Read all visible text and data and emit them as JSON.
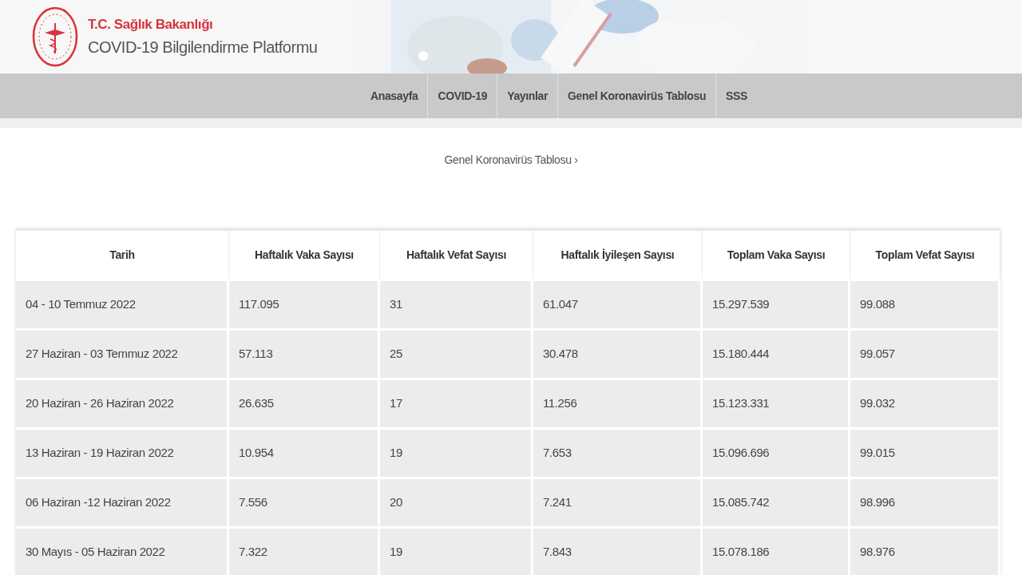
{
  "header": {
    "ministry": "T.C. Sağlık Bakanlığı",
    "platform": "COVID-19 Bilgilendirme Platformu"
  },
  "nav": [
    {
      "label": "Anasayfa"
    },
    {
      "label": "COVID-19"
    },
    {
      "label": "Yayınlar"
    },
    {
      "label": "Genel Koronavirüs Tablosu"
    },
    {
      "label": "SSS"
    }
  ],
  "breadcrumb": {
    "label": "Genel Koronavirüs Tablosu",
    "chevron": "›"
  },
  "table": {
    "columns": [
      "Tarih",
      "Haftalık Vaka Sayısı",
      "Haftalık Vefat Sayısı",
      "Haftalık İyileşen Sayısı",
      "Toplam Vaka Sayısı",
      "Toplam Vefat Sayısı"
    ],
    "rows": [
      [
        "04 - 10 Temmuz 2022",
        "117.095",
        "31",
        "61.047",
        "15.297.539",
        "99.088"
      ],
      [
        "27 Haziran - 03 Temmuz 2022",
        "57.113",
        "25",
        "30.478",
        "15.180.444",
        "99.057"
      ],
      [
        "20 Haziran - 26 Haziran 2022",
        "26.635",
        "17",
        "11.256",
        "15.123.331",
        "99.032"
      ],
      [
        "13 Haziran - 19 Haziran 2022",
        "10.954",
        "19",
        "7.653",
        "15.096.696",
        "99.015"
      ],
      [
        "06 Haziran -12 Haziran 2022",
        "7.556",
        "20",
        "7.241",
        "15.085.742",
        "98.996"
      ],
      [
        "30 Mayıs - 05 Haziran 2022",
        "7.322",
        "19",
        "7.843",
        "15.078.186",
        "98.976"
      ]
    ]
  }
}
